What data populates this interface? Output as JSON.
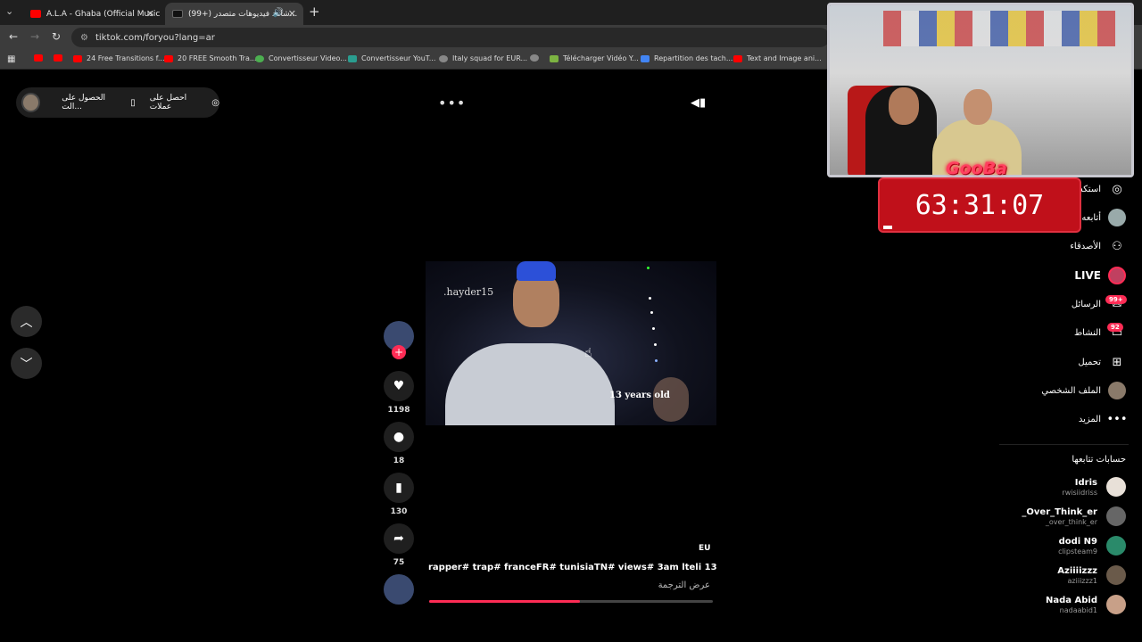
{
  "browser": {
    "tabs": [
      {
        "title": "A.L.A - Ghaba (Official Music V...",
        "favicon_color": "#ff0000"
      },
      {
        "title": "(99+) شاهد فيديوهات متصدر...",
        "favicon_color": "#111111",
        "active": true
      }
    ],
    "url": "tiktok.com/foryou?lang=ar",
    "bookmarks": [
      {
        "label": "",
        "color": "#ff0000"
      },
      {
        "label": "",
        "color": "#ff0000"
      },
      {
        "label": "24 Free Transitions f...",
        "color": "#ff0000"
      },
      {
        "label": "20 FREE Smooth Tra...",
        "color": "#ff0000"
      },
      {
        "label": "Convertisseur Video...",
        "color": "#4caf50"
      },
      {
        "label": "Convertisseur YouT...",
        "color": "#2a9d8f"
      },
      {
        "label": "Italy squad for EUR...",
        "color": "#888888"
      },
      {
        "label": "",
        "color": "#888888"
      },
      {
        "label": "Télécharger Vidéo Y...",
        "color": "#7cb342"
      },
      {
        "label": "Repartition des tach...",
        "color": "#4285f4"
      },
      {
        "label": "Text and Image ani...",
        "color": "#ff0000"
      }
    ]
  },
  "header": {
    "get_app": "الحصول على الت...",
    "get_coins": "احصل على عملات",
    "more": "•••"
  },
  "video": {
    "watermark": ".hayder15",
    "overlay_text": "13 years old",
    "region": "EU",
    "description": "rapper# trap# franceFR# tunisiaTN# views# 3am lteli 13",
    "translate": "عرض الترجمة",
    "progress": 0.53
  },
  "actions": {
    "likes": "1198",
    "comments": "18",
    "saves": "130",
    "shares": "75"
  },
  "sidebar": {
    "items": [
      {
        "label": "استكشف",
        "icon": "compass-icon"
      },
      {
        "label": "أتابعه",
        "icon": "following-icon"
      },
      {
        "label": "الأصدقاء",
        "icon": "friends-icon"
      },
      {
        "label": "LIVE",
        "icon": "live-icon"
      },
      {
        "label": "الرسائل",
        "icon": "messages-icon",
        "badge": "99+"
      },
      {
        "label": "النشاط",
        "icon": "activity-icon",
        "badge": "92"
      },
      {
        "label": "تحميل",
        "icon": "upload-icon"
      },
      {
        "label": "الملف الشخصي",
        "icon": "profile-icon"
      },
      {
        "label": "المزيد",
        "icon": "more-icon"
      }
    ],
    "following_title": "حسابات تتابعها",
    "accounts": [
      {
        "name": "Idris",
        "handle": "rwisiidriss",
        "color": "#e8e0d8"
      },
      {
        "name": "_Over_Think_er",
        "handle": "_over_think_er",
        "color": "#666666"
      },
      {
        "name": "dodi N9",
        "handle": "clipsteam9",
        "color": "#2a8a6a"
      },
      {
        "name": "Aziiiizzz",
        "handle": "aziiizzz1",
        "color": "#6a5a4a"
      },
      {
        "name": "Nada Abid",
        "handle": "nadaabid1",
        "color": "#c8a088"
      }
    ]
  },
  "overlay": {
    "brand": "GooBa",
    "timer": "63:31:07"
  }
}
